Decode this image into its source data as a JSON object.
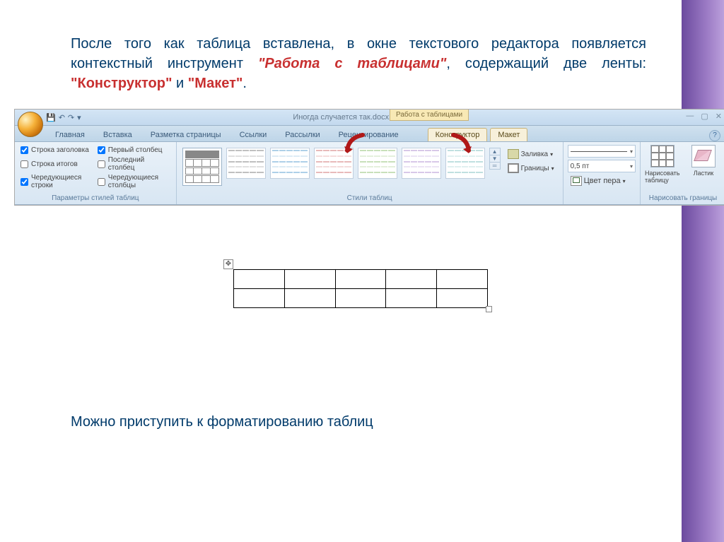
{
  "paragraph": {
    "pre": "После того как таблица вставлена, в окне текстового редактора появляется контекстный инструмент ",
    "tool": "\"Работа с таблицами\"",
    "mid1": ", содержащий две ленты: ",
    "tab1": "\"Конструктор\"",
    "and": " и ",
    "tab2": "\"Макет\"",
    "dot": "."
  },
  "ribbon": {
    "qat": {
      "save": "💾",
      "undo": "↶",
      "redo": "↷",
      "dd": "▾"
    },
    "doc_title": "Иногда случается так.docx - Microsoft Word",
    "context_label": "Работа с таблицами",
    "window": {
      "min": "—",
      "max": "▢",
      "close": "✕"
    },
    "tabs": {
      "home": "Главная",
      "insert": "Вставка",
      "layout": "Разметка страницы",
      "refs": "Ссылки",
      "mail": "Рассылки",
      "review": "Рецензирование",
      "ctx_design": "Конструктор",
      "ctx_layout": "Макет"
    },
    "help": "?",
    "style_opts": {
      "header_row": "Строка заголовка",
      "total_row": "Строка итогов",
      "banded_rows": "Чередующиеся строки",
      "first_col": "Первый столбец",
      "last_col": "Последний столбец",
      "banded_cols": "Чередующиеся столбцы",
      "group_label": "Параметры стилей таблиц"
    },
    "styles_group": {
      "shading": "Заливка",
      "borders": "Границы",
      "label": "Стили таблиц"
    },
    "draw": {
      "width": "0,5 пт",
      "pen_color": "Цвет пера",
      "draw_table": "Нарисовать таблицу",
      "eraser": "Ластик",
      "label": "Нарисовать границы"
    },
    "checks": {
      "header_row": true,
      "total_row": false,
      "banded_rows": true,
      "first_col": true,
      "last_col": false,
      "banded_cols": false
    }
  },
  "bottom": "Можно приступить к форматированию таблиц"
}
